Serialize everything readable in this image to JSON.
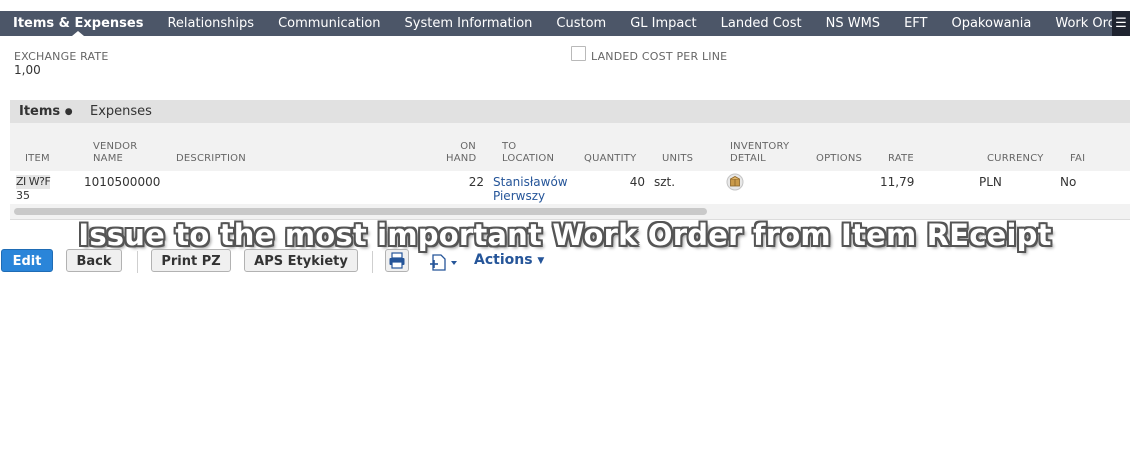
{
  "tabs": [
    {
      "label": "Items & Expenses",
      "active": true
    },
    {
      "label": "Relationships"
    },
    {
      "label": "Communication"
    },
    {
      "label": "System Information"
    },
    {
      "label": "Custom"
    },
    {
      "label": "GL Impact"
    },
    {
      "label": "Landed Cost"
    },
    {
      "label": "NS WMS"
    },
    {
      "label": "EFT"
    },
    {
      "label": "Opakowania"
    },
    {
      "label": "Work Order"
    }
  ],
  "fields": {
    "exchange_rate_label": "EXCHANGE RATE",
    "exchange_rate_value": "1,00",
    "landed_cost_per_line_label": "LANDED COST PER LINE"
  },
  "subtabs": {
    "items": "Items",
    "expenses": "Expenses"
  },
  "table": {
    "headers": {
      "item": "ITEM",
      "vendor_name_1": "VENDOR",
      "vendor_name_2": "NAME",
      "description": "DESCRIPTION",
      "on_hand_1": "ON",
      "on_hand_2": "HAND",
      "to_location_1": "TO",
      "to_location_2": "LOCATION",
      "quantity": "QUANTITY",
      "units": "UNITS",
      "inventory_detail_1": "INVENTORY",
      "inventory_detail_2": "DETAIL",
      "options": "OPTIONS",
      "rate": "RATE",
      "currency": "CURRENCY",
      "fai": "FAI"
    },
    "rows": [
      {
        "item_1": "ZI W?F",
        "item_2": "35",
        "vendor_name": "1010500000",
        "description": "",
        "on_hand": "22",
        "to_location_1": "Stanisławów",
        "to_location_2": "Pierwszy",
        "quantity": "40",
        "units": "szt.",
        "options": "",
        "rate": "11,79",
        "currency": "PLN",
        "fai": "No"
      }
    ]
  },
  "caption": "Issue to the most important Work Order from Item REceipt",
  "buttons": {
    "edit": "Edit",
    "back": "Back",
    "print_pz": "Print PZ",
    "aps_etykiety": "APS Etykiety",
    "actions": "Actions"
  },
  "colors": {
    "tabbar_bg": "#4c5668",
    "primary_button": "#2a85d9",
    "link": "#255599"
  }
}
